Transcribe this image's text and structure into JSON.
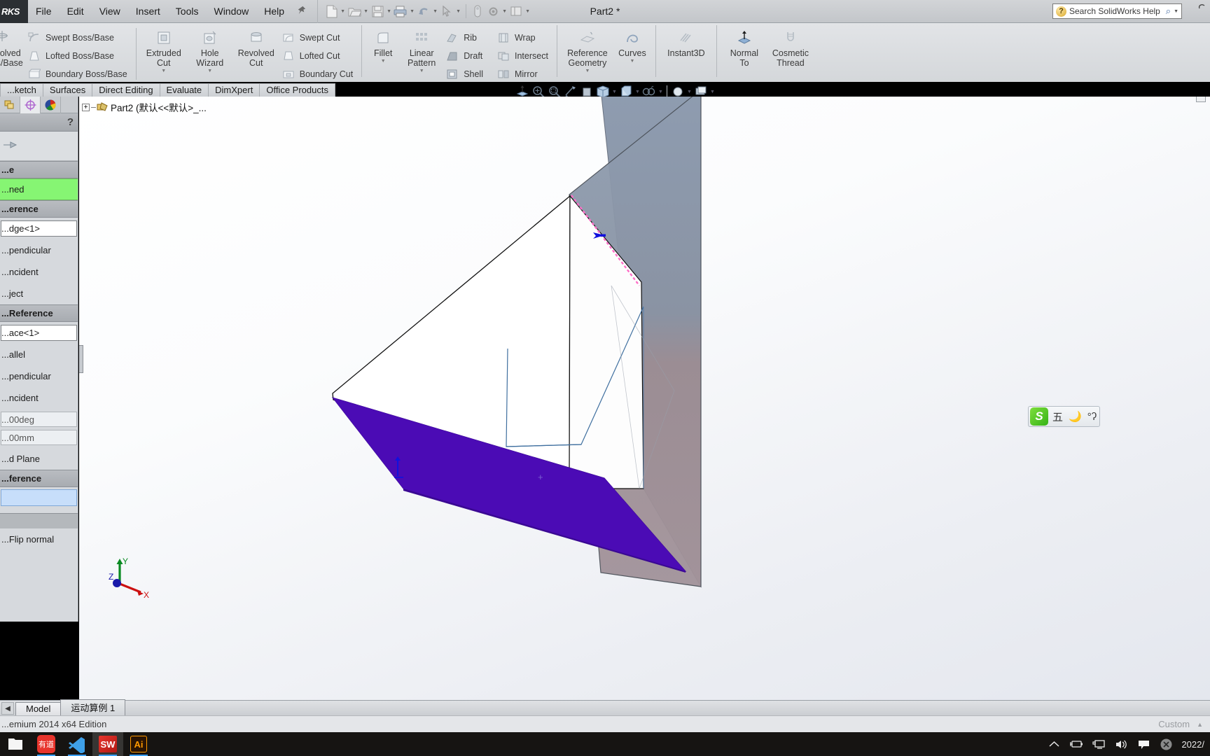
{
  "window": {
    "logo": "RKS",
    "doc_title": "Part2 *",
    "menus": [
      "File",
      "Edit",
      "View",
      "Insert",
      "Tools",
      "Window",
      "Help"
    ],
    "pin_icon": "pushpin-icon",
    "close_label": "×"
  },
  "quick_access": [
    {
      "name": "new-document-button",
      "icon": "new-doc-icon",
      "caret": true
    },
    {
      "name": "open-document-button",
      "icon": "open-folder-icon",
      "caret": true
    },
    {
      "name": "save-button",
      "icon": "save-disk-icon",
      "caret": true
    },
    {
      "name": "print-button",
      "icon": "printer-icon",
      "caret": true
    },
    {
      "name": "undo-button",
      "icon": "undo-arrow-icon",
      "caret": true
    },
    {
      "name": "select-button",
      "icon": "cursor-arrow-icon",
      "caret": true
    },
    {
      "name": "rebuild-button",
      "icon": "rebuild-icon",
      "caret": false
    },
    {
      "name": "options-button",
      "icon": "gear-icon",
      "caret": true
    }
  ],
  "help_search": {
    "placeholder": "Search SolidWorks Help",
    "value": "",
    "icon": "question-mark-icon",
    "search_icon": "magnifier-icon"
  },
  "ribbon": {
    "group_features": {
      "big": [
        {
          "label": "...evolved\nBoss/Base",
          "icon": "revolved-boss-icon",
          "dropdown": false
        },
        {
          "label": "Extruded\nCut",
          "icon": "extruded-cut-icon",
          "dropdown": true
        },
        {
          "label": "Hole\nWizard",
          "icon": "hole-wizard-icon",
          "dropdown": true
        },
        {
          "label": "Revolved\nCut",
          "icon": "revolved-cut-icon",
          "dropdown": false
        }
      ],
      "small_left": [
        {
          "label": "Swept Boss/Base",
          "icon": "swept-boss-icon"
        },
        {
          "label": "Lofted Boss/Base",
          "icon": "lofted-boss-icon"
        },
        {
          "label": "Boundary Boss/Base",
          "icon": "boundary-boss-icon"
        }
      ],
      "small_cuts": [
        {
          "label": "Swept Cut",
          "icon": "swept-cut-icon"
        },
        {
          "label": "Lofted Cut",
          "icon": "lofted-cut-icon"
        },
        {
          "label": "Boundary Cut",
          "icon": "boundary-cut-icon"
        }
      ]
    },
    "group_modify": {
      "big": [
        {
          "label": "Fillet",
          "icon": "fillet-icon",
          "dropdown": true
        },
        {
          "label": "Linear\nPattern",
          "icon": "linear-pattern-icon",
          "dropdown": true
        }
      ],
      "small_a": [
        {
          "label": "Rib",
          "icon": "rib-icon"
        },
        {
          "label": "Draft",
          "icon": "draft-icon"
        },
        {
          "label": "Shell",
          "icon": "shell-icon"
        }
      ],
      "small_b": [
        {
          "label": "Wrap",
          "icon": "wrap-icon"
        },
        {
          "label": "Intersect",
          "icon": "intersect-icon"
        },
        {
          "label": "Mirror",
          "icon": "mirror-icon"
        }
      ]
    },
    "group_reference": [
      {
        "label": "Reference\nGeometry",
        "icon": "reference-geometry-icon",
        "dropdown": true
      },
      {
        "label": "Curves",
        "icon": "curves-icon",
        "dropdown": true
      }
    ],
    "group_instant": [
      {
        "label": "Instant3D",
        "icon": "instant3d-icon",
        "dropdown": false
      }
    ],
    "group_normal": [
      {
        "label": "Normal\nTo",
        "icon": "normal-to-icon",
        "dropdown": false
      },
      {
        "label": "Cosmetic\nThread",
        "icon": "cosmetic-thread-icon",
        "dropdown": false
      }
    ]
  },
  "command_tabs": [
    {
      "label": "...ketch",
      "active": false
    },
    {
      "label": "Surfaces",
      "active": false
    },
    {
      "label": "Direct Editing",
      "active": false
    },
    {
      "label": "Evaluate",
      "active": false
    },
    {
      "label": "DimXpert",
      "active": false
    },
    {
      "label": "Office Products",
      "active": false
    }
  ],
  "view_toolbar": [
    {
      "name": "view-orientation-button",
      "icon": "view-orientation-icon",
      "caret": false
    },
    {
      "name": "zoom-to-fit-button",
      "icon": "zoom-fit-icon",
      "caret": false
    },
    {
      "name": "zoom-to-area-button",
      "icon": "zoom-area-icon",
      "caret": false
    },
    {
      "name": "section-view-button",
      "icon": "section-view-icon",
      "caret": false
    },
    {
      "name": "view-orientation-cube-button",
      "icon": "view-cube-icon",
      "caret": false
    },
    {
      "name": "display-style-button",
      "icon": "display-style-icon",
      "caret": true
    },
    {
      "name": "hide-show-items-button",
      "icon": "hide-show-icon",
      "caret": true
    },
    {
      "name": "appearances-button",
      "icon": "appearances-icon",
      "caret": true
    },
    {
      "name": "scene-button",
      "icon": "scene-icon",
      "caret": true
    },
    {
      "name": "view-settings-button",
      "icon": "view-settings-icon",
      "caret": true
    }
  ],
  "property_manager": {
    "tabs": [
      {
        "name": "feature-tree-tab",
        "icon": "feature-tree-icon",
        "active": false
      },
      {
        "name": "property-manager-tab",
        "icon": "property-manager-icon",
        "active": true
      },
      {
        "name": "appearance-manager-tab",
        "icon": "color-wheel-icon",
        "active": false
      }
    ],
    "title": "...e",
    "help_glyph": "?",
    "message_label": "...",
    "rows": [
      {
        "kind": "section",
        "label": "...e"
      },
      {
        "kind": "green",
        "label": "...ned"
      },
      {
        "kind": "section",
        "label": "...erence"
      },
      {
        "kind": "white",
        "label": "...dge<1>"
      },
      {
        "kind": "plain",
        "label": "...pendicular"
      },
      {
        "kind": "plain",
        "label": "...ncident"
      },
      {
        "kind": "plain",
        "label": "...ject"
      },
      {
        "kind": "section",
        "label": "...Reference"
      },
      {
        "kind": "white",
        "label": "...ace<1>"
      },
      {
        "kind": "plain",
        "label": "...allel"
      },
      {
        "kind": "plain",
        "label": "...pendicular"
      },
      {
        "kind": "plain",
        "label": "...ncident"
      },
      {
        "kind": "field",
        "label": "...00deg"
      },
      {
        "kind": "field",
        "label": "...00mm"
      },
      {
        "kind": "plain",
        "label": "...d Plane"
      },
      {
        "kind": "section",
        "label": "...ference"
      },
      {
        "kind": "blue",
        "label": ""
      },
      {
        "kind": "gray",
        "label": ""
      },
      {
        "kind": "plain",
        "label": "...Flip normal"
      }
    ]
  },
  "feature_tree": {
    "expand_glyph": "+",
    "icon": "part-document-icon",
    "label": "Part2  (默认<<默认>_..."
  },
  "graphics": {
    "triad": {
      "x_label": "X",
      "y_label": "Y",
      "z_label": "Z"
    },
    "colors": {
      "selected_face": "#4b0bb5",
      "plane_fill": "#8b96a8",
      "plane_fill_lower": "#9b8d94",
      "selected_edge": "#ff6ec7",
      "arrow": "#1111dd",
      "model_face": "#ffffff",
      "edge_line": "#111111",
      "sketch_line": "#3f6f9f",
      "background_top": "#ffffff",
      "background_bottom": "#e4e7ee"
    }
  },
  "bottom_tabs": {
    "prev_glyph": "◀",
    "next_glyph": "▶",
    "tabs": [
      {
        "label": "Model",
        "active": true
      },
      {
        "label": "运动算例 1",
        "active": false
      }
    ]
  },
  "status_bar": {
    "left_text": "...emium 2014 x64 Edition",
    "right_text": "Custom",
    "right_caret": "▲"
  },
  "taskbar": {
    "apps": [
      {
        "name": "taskbar-icon-file-explorer",
        "label": "",
        "icon": "folder-icon",
        "active": false
      },
      {
        "name": "taskbar-icon-youdao",
        "label": "有道",
        "icon": "youdao-icon",
        "active": false
      },
      {
        "name": "taskbar-icon-vscode",
        "label": "",
        "icon": "vscode-icon",
        "active": false
      },
      {
        "name": "taskbar-icon-solidworks",
        "label": "SW",
        "icon": "solidworks-icon",
        "active": true
      },
      {
        "name": "taskbar-icon-illustrator",
        "label": "Ai",
        "icon": "illustrator-icon",
        "active": false
      }
    ],
    "tray": [
      {
        "name": "show-hidden-icons-button",
        "icon": "chevron-up-icon"
      },
      {
        "name": "battery-icon",
        "icon": "battery-icon"
      },
      {
        "name": "network-icon",
        "icon": "network-monitor-icon"
      },
      {
        "name": "volume-icon",
        "icon": "speaker-icon"
      },
      {
        "name": "notifications-icon",
        "icon": "notification-flag-icon"
      },
      {
        "name": "close-overlay-icon",
        "icon": "close-circle-icon"
      }
    ],
    "clock": "2022/"
  },
  "ime_bar": {
    "logo": "S",
    "mode": "五",
    "moon_icon": "moon-icon",
    "extra": "°ʔ"
  }
}
